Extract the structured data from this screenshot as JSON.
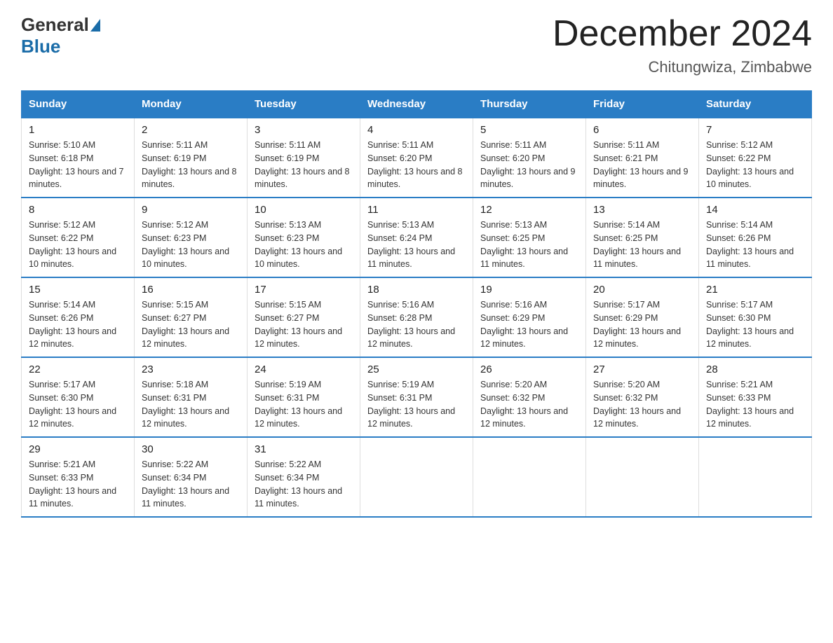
{
  "header": {
    "logo_general": "General",
    "logo_blue": "Blue",
    "title": "December 2024",
    "subtitle": "Chitungwiza, Zimbabwe"
  },
  "columns": [
    "Sunday",
    "Monday",
    "Tuesday",
    "Wednesday",
    "Thursday",
    "Friday",
    "Saturday"
  ],
  "weeks": [
    [
      {
        "day": "1",
        "sunrise": "5:10 AM",
        "sunset": "6:18 PM",
        "daylight": "13 hours and 7 minutes."
      },
      {
        "day": "2",
        "sunrise": "5:11 AM",
        "sunset": "6:19 PM",
        "daylight": "13 hours and 8 minutes."
      },
      {
        "day": "3",
        "sunrise": "5:11 AM",
        "sunset": "6:19 PM",
        "daylight": "13 hours and 8 minutes."
      },
      {
        "day": "4",
        "sunrise": "5:11 AM",
        "sunset": "6:20 PM",
        "daylight": "13 hours and 8 minutes."
      },
      {
        "day": "5",
        "sunrise": "5:11 AM",
        "sunset": "6:20 PM",
        "daylight": "13 hours and 9 minutes."
      },
      {
        "day": "6",
        "sunrise": "5:11 AM",
        "sunset": "6:21 PM",
        "daylight": "13 hours and 9 minutes."
      },
      {
        "day": "7",
        "sunrise": "5:12 AM",
        "sunset": "6:22 PM",
        "daylight": "13 hours and 10 minutes."
      }
    ],
    [
      {
        "day": "8",
        "sunrise": "5:12 AM",
        "sunset": "6:22 PM",
        "daylight": "13 hours and 10 minutes."
      },
      {
        "day": "9",
        "sunrise": "5:12 AM",
        "sunset": "6:23 PM",
        "daylight": "13 hours and 10 minutes."
      },
      {
        "day": "10",
        "sunrise": "5:13 AM",
        "sunset": "6:23 PM",
        "daylight": "13 hours and 10 minutes."
      },
      {
        "day": "11",
        "sunrise": "5:13 AM",
        "sunset": "6:24 PM",
        "daylight": "13 hours and 11 minutes."
      },
      {
        "day": "12",
        "sunrise": "5:13 AM",
        "sunset": "6:25 PM",
        "daylight": "13 hours and 11 minutes."
      },
      {
        "day": "13",
        "sunrise": "5:14 AM",
        "sunset": "6:25 PM",
        "daylight": "13 hours and 11 minutes."
      },
      {
        "day": "14",
        "sunrise": "5:14 AM",
        "sunset": "6:26 PM",
        "daylight": "13 hours and 11 minutes."
      }
    ],
    [
      {
        "day": "15",
        "sunrise": "5:14 AM",
        "sunset": "6:26 PM",
        "daylight": "13 hours and 12 minutes."
      },
      {
        "day": "16",
        "sunrise": "5:15 AM",
        "sunset": "6:27 PM",
        "daylight": "13 hours and 12 minutes."
      },
      {
        "day": "17",
        "sunrise": "5:15 AM",
        "sunset": "6:27 PM",
        "daylight": "13 hours and 12 minutes."
      },
      {
        "day": "18",
        "sunrise": "5:16 AM",
        "sunset": "6:28 PM",
        "daylight": "13 hours and 12 minutes."
      },
      {
        "day": "19",
        "sunrise": "5:16 AM",
        "sunset": "6:29 PM",
        "daylight": "13 hours and 12 minutes."
      },
      {
        "day": "20",
        "sunrise": "5:17 AM",
        "sunset": "6:29 PM",
        "daylight": "13 hours and 12 minutes."
      },
      {
        "day": "21",
        "sunrise": "5:17 AM",
        "sunset": "6:30 PM",
        "daylight": "13 hours and 12 minutes."
      }
    ],
    [
      {
        "day": "22",
        "sunrise": "5:17 AM",
        "sunset": "6:30 PM",
        "daylight": "13 hours and 12 minutes."
      },
      {
        "day": "23",
        "sunrise": "5:18 AM",
        "sunset": "6:31 PM",
        "daylight": "13 hours and 12 minutes."
      },
      {
        "day": "24",
        "sunrise": "5:19 AM",
        "sunset": "6:31 PM",
        "daylight": "13 hours and 12 minutes."
      },
      {
        "day": "25",
        "sunrise": "5:19 AM",
        "sunset": "6:31 PM",
        "daylight": "13 hours and 12 minutes."
      },
      {
        "day": "26",
        "sunrise": "5:20 AM",
        "sunset": "6:32 PM",
        "daylight": "13 hours and 12 minutes."
      },
      {
        "day": "27",
        "sunrise": "5:20 AM",
        "sunset": "6:32 PM",
        "daylight": "13 hours and 12 minutes."
      },
      {
        "day": "28",
        "sunrise": "5:21 AM",
        "sunset": "6:33 PM",
        "daylight": "13 hours and 12 minutes."
      }
    ],
    [
      {
        "day": "29",
        "sunrise": "5:21 AM",
        "sunset": "6:33 PM",
        "daylight": "13 hours and 11 minutes."
      },
      {
        "day": "30",
        "sunrise": "5:22 AM",
        "sunset": "6:34 PM",
        "daylight": "13 hours and 11 minutes."
      },
      {
        "day": "31",
        "sunrise": "5:22 AM",
        "sunset": "6:34 PM",
        "daylight": "13 hours and 11 minutes."
      },
      {
        "day": "",
        "sunrise": "",
        "sunset": "",
        "daylight": ""
      },
      {
        "day": "",
        "sunrise": "",
        "sunset": "",
        "daylight": ""
      },
      {
        "day": "",
        "sunrise": "",
        "sunset": "",
        "daylight": ""
      },
      {
        "day": "",
        "sunrise": "",
        "sunset": "",
        "daylight": ""
      }
    ]
  ]
}
